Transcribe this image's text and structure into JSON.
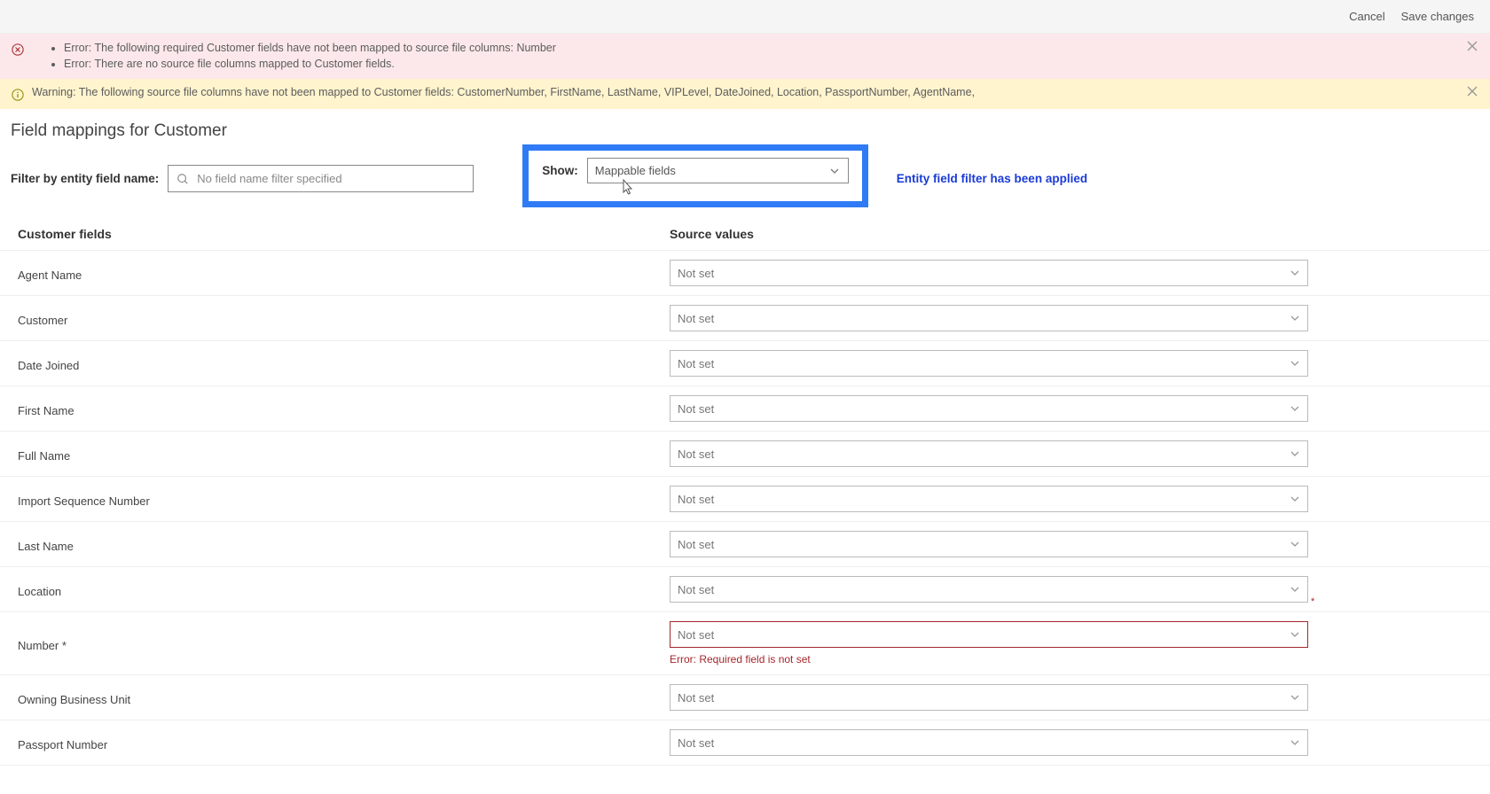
{
  "header": {
    "cancel": "Cancel",
    "save": "Save changes"
  },
  "errorBanner": {
    "items": [
      "Error: The following required Customer fields have not been mapped to source file columns: Number",
      "Error: There are no source file columns mapped to Customer fields."
    ]
  },
  "warningBanner": {
    "text": "Warning: The following source file columns have not been mapped to Customer fields: CustomerNumber, FirstName, LastName, VIPLevel, DateJoined, Location, PassportNumber, AgentName,"
  },
  "pageTitle": "Field mappings for Customer",
  "filter": {
    "label": "Filter by entity field name:",
    "placeholder": "No field name filter specified",
    "showLabel": "Show:",
    "showValue": "Mappable fields",
    "statusMsg": "Entity field filter has been applied"
  },
  "table": {
    "headerLeft": "Customer fields",
    "headerRight": "Source values",
    "notSet": "Not set",
    "requiredError": "Error: Required field is not set",
    "rows": [
      {
        "label": "Agent Name",
        "value": "Not set",
        "required": false
      },
      {
        "label": "Customer",
        "value": "Not set",
        "required": false
      },
      {
        "label": "Date Joined",
        "value": "Not set",
        "required": false
      },
      {
        "label": "First Name",
        "value": "Not set",
        "required": false
      },
      {
        "label": "Full Name",
        "value": "Not set",
        "required": false
      },
      {
        "label": "Import Sequence Number",
        "value": "Not set",
        "required": false
      },
      {
        "label": "Last Name",
        "value": "Not set",
        "required": false
      },
      {
        "label": "Location",
        "value": "Not set",
        "required": false
      },
      {
        "label": "Number *",
        "value": "Not set",
        "required": true
      },
      {
        "label": "Owning Business Unit",
        "value": "Not set",
        "required": false
      },
      {
        "label": "Passport Number",
        "value": "Not set",
        "required": false
      }
    ]
  }
}
